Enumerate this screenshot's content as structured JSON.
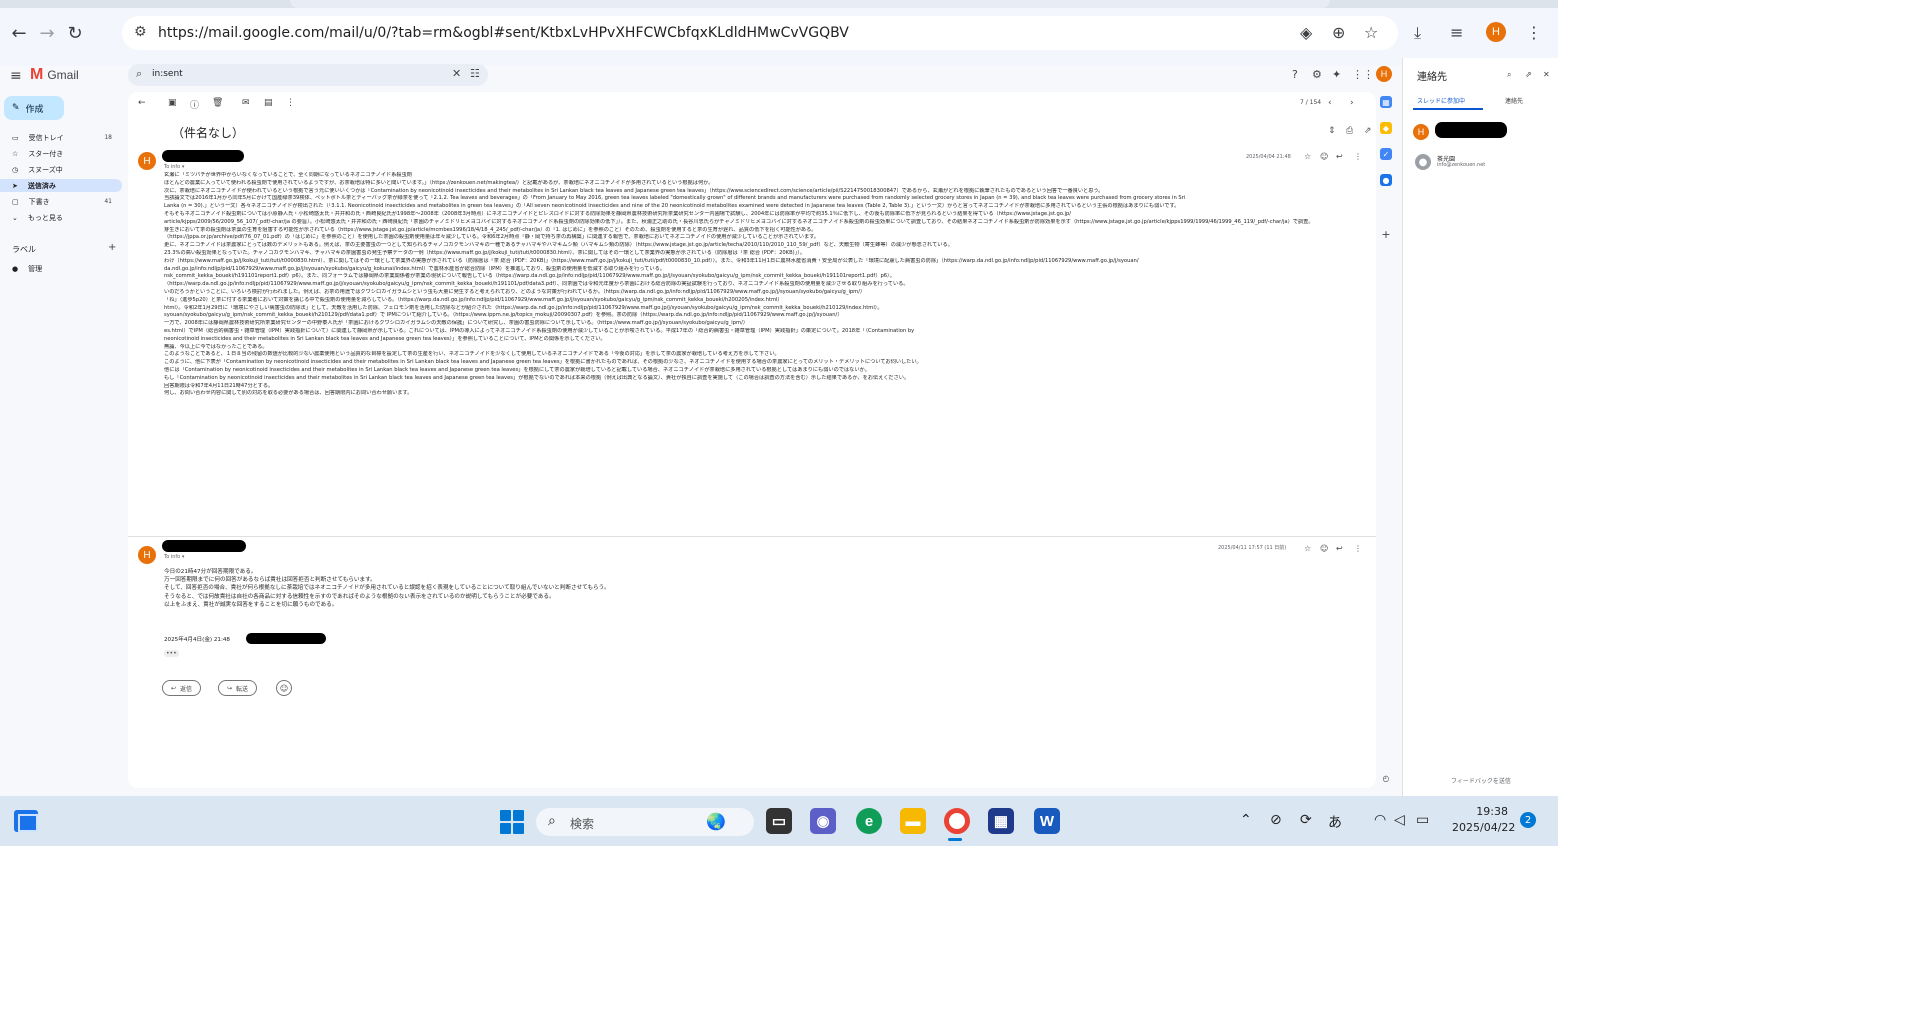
{
  "browser": {
    "url": "https://mail.google.com/mail/u/0/?tab=rm&ogbl#sent/KtbxLvHPvXHFCWCbfqxKLdldHMwCvVGQBV",
    "profile_initial": "H"
  },
  "gmail": {
    "brand": "Gmail",
    "search_value": "in:sent",
    "compose_label": "作成",
    "nav": [
      {
        "label": "受信トレイ",
        "count": "18"
      },
      {
        "label": "スター付き",
        "count": ""
      },
      {
        "label": "スヌーズ中",
        "count": ""
      },
      {
        "label": "送信済み",
        "count": ""
      },
      {
        "label": "下書き",
        "count": "41"
      },
      {
        "label": "もっと見る",
        "count": ""
      }
    ],
    "labels_heading": "ラベル",
    "labels": [
      {
        "label": "管理"
      }
    ],
    "profile_initial": "H"
  },
  "thread": {
    "pager": "7 / 154",
    "subject": "（件名なし）",
    "messages": [
      {
        "avatar": "H",
        "to": "To info ▾",
        "date": "2025/04/04 21:48",
        "body": [
          "玄瀬に「ミツバチが世界中からいなくなっていることで、全く同期になっているネオニコチノイド系殺虫剤",
          "ほとんどの農業に入っていて使われる殺虫剤で使用されているようですが、お茶栽培は特に多いと聞いています。」（https://zenkouen.net/makingtea/）と記載があるが、茶栽培にネオニコチノイドが多用されているという根拠は何か。",
          "次に、茶栽培にネオニコチノイドが使われているという根拠で言う元に使いいくつかは「Contamination by neonicotinoid insecticides and their metabolites in Sri Lankan black tea leaves and Japanese green tea leaves」（https://www.sciencedirect.com/science/article/pii/S2214750018300847）であるから、玄瀬がどれを根拠に執筆されたものであるという回答で一番良いと思う。",
          "当該論文では2016年1月から同年5月にかけて国産緑茶39検体、ペットボトル茶とティーバッグ茶が緑茶を使って「2.1.2. Tea leaves and beverages」の「From January to May 2016, green tea leaves labeled \"domestically grown\" of different brands and manufacturers were purchased from randomly selected grocery stores in Japan (n = 39), and black tea leaves were purchased from grocery stores in Sri",
          "Lanka (n = 30).」という一文）各々ネオニコチノイドが検出された（「3.1.1. Neonicotinoid insecticides and metabolites in green tea leaves」の「All seven neonicotinoid insecticides and nine of the 20 neonicotinoid metabolites examined were detected in Japanese tea leaves (Table 2, Table 3).」という一文）からと言ってネオニコチノイドが茶栽培に多用されているという主張の根拠はあまりにも弱いです。",
          "そもそもネオニコチノイド殺虫剤については小原静人氏・小松崎悠太氏・井井和の氏・西崎良紀氏が1998年〜2008年（2008年3月時点）にネオニコチノイドとピレスロイドに対する防除効果を静岡県農林技術研究所茶業研究センター内圃場で試験し、2004年には防除率が平均で約35.1％に低下し、その後も防除率に低下が見られるという結果を得ている（https://www.jstage.jst.go.jp/",
          "article/kjpps/2009/56/2009_56_107/_pdf/-char/ja の要旨）。小松崎悠太氏・井井和の氏・西崎良紀氏「茶園のチャノミドリヒメヨコバイに対するネオニコチノイド系殺虫剤の防除効果の低下」）。また、秋浦正之助の氏・長谷川忠氏らがチャノミドリヒメヨコバイに対するネオニコチノイド系殺虫剤の殺虫効果について調査しており、その結果ネオニコチノイド系殺虫剤が防除効果を示す（https://www.jstage.jst.go.jp/article/kjpps1999/1999/46/1999_46_119/_pdf/-char/ja）で調査。",
          "芽生きにおいて茶の殺虫剤は茶葉の生育を阻害する可能性が示されている（https://www.jstage.jst.go.jp/article/mcmbes1996/18/4/18_4_245/_pdf/-char/ja）の「1. はじめに」を参照のこと）そのため、殺虫剤を使用すると茶の生育が遅れ、品質の低下を招く可能性がある。",
          "（https://jppa.or.jp/archive/pdf/76_07_01.pdf）の「はじめに」を参照のこと）を使用した茶園の殺虫剤使用量は年々減少している。令和6年2月時点「静・岡で持ち茶の再構築」に関連する報告で、茶栽培においてネオニコチノイドの使用が減少していることが示されています。",
          "更に、ネオニコチノイドは茶農家にとっては数のデメリットもある。例えば、茶の主要害虫の一つとして知られるチャノコカクモンハマキの一種であるチャハマキやハマキムシ類（ハマキムシ類の防除）（https://www.jstage.jst.go.jp/article/techa/2010/110/2010_110_59/_pdf）など、天敵生物（寄生蜂等）の減少が懸念されている。",
          "23.3%の高い殺虫効果となっていた。チャノコカクモンハマキ、チャハマキの茶園害虫の発生予察データの一例（https://www.maff.go.jp/j/kokuji_tuti/tuti/t0000830.html）、茶に関してはその一環として茶業界の実態が示されている（防除暦は「茶 総合 (PDF：20KB)」）。",
          "わけ（https://www.maff.go.jp/j/kokuji_tuti/tuti/t0000830.html）、茶に関してはその一環として茶業界の実態が示されている（防除暦は「茶 総合 (PDF：20KB)」（https://www.maff.go.jp/j/kokuji_tuti/tuti/pdf/t0000830_10.pdf））。また、令和3年11月1日に農林水産省消費・安全局が公表した「環境に配慮した病害虫の防除」（https://warp.da.ndl.go.jp/info:ndljp/pid/11067929/www.maff.go.jp/j/syouan/",
          "da.ndl.go.jp/info:ndljp/pid/11067929/www.maff.go.jp/j/syouan/syokubo/gaicyu/g_kokunai/index.html）で農林水産省が総合防除（IPM）を推進しており、殺虫剤の使用量を低減する取り組みを行っている。",
          "nsk_commit_kekka_boueki/h191101report1.pdf）p6）。また、同フォーラムでは静岡県の茶業関係者が茶業の現状について報告している（https://warp.da.ndl.go.jp/info:ndljp/pid/11067929/www.maff.go.jp/j/syouan/syokubo/gaicyu/g_ipm/nsk_commit_kekka_boueki/h191101report1.pdf）p6）。",
          "（https://warp.da.ndl.go.jp/info:ndljp/pid/11067929/www.maff.go.jp/j/syouan/syokubo/gaicyu/g_ipm/nsk_commit_kekka_boueki/h191101/pdf/data3.pdf）、同茶園では令和元年度から茶園における総合防除の実証試験を行っており、ネオニコチノイド系殺虫剤の使用量を減少させる取り組みを行っている。",
          "いのだろうかということに、いろいろ検討が行われました。例えば、お茶の用途ではクワシロカイガラムシという虫も大量に発生すると考えられており、どのような対策が行われているか。（https://warp.da.ndl.go.jp/info:ndljp/pid/11067929/www.maff.go.jp/j/syouan/syokubo/gaicyu/g_ipm/）",
          "「ね」（進歩5p20）と茶に付する茶業者において対策を講じる中で殺虫剤の使用量を減らしている。（https://warp.da.ndl.go.jp/info:ndljp/pid/11067929/www.maff.go.jp/j/syouan/syokubo/gaicyu/g_ipm/nsk_commit_kekka_boueki/h200205/index.html）",
          "html）。令和2年1月29日に「環境にやさしい病害虫の防除法」として、天敵を活用した防除、フェロモン剤を活用した防除などが紹介された（https://warp.da.ndl.go.jp/info:ndljp/pid/11067929/www.maff.go.jp/j/syouan/syokubo/gaicyu/g_ipm/nsk_commit_kekka_boueki/h210129/index.html）。",
          "syouan/syokubo/gaicyu/g_ipm/nsk_commit_kekka_boueki/h210129/pdf/data1.pdf）で IPMについて紹介している。（https://www.ippm.ne.jp/topics_mokuji/20090307.pdf）を参照。茶の防除（https://warp.da.ndl.go.jp/info:ndljp/pid/11067929/www.maff.go.jp/j/syouan/）",
          "一方で、2008年には静岡県農林技術研究所茶業研究センターの中野泰人氏が「茶園におけるクワシロカイガラムシの天敵の保護」について研究し、茶園の害虫防除について示している。（https://www.maff.go.jp/j/syouan/syokubo/gaicyu/g_ipm/）",
          "es.html）でIPM（総合的病害虫・雑草管理（IPM）実践指針について）に関連して静岡県が示している。これについては、IPMの導入によってネオニコチノイド系殺虫剤の使用が減少していることが示唆されている。平成17年の「総合的病害虫・雑草管理（IPM）実践指針」の策定について。2018年「（Contamination by",
          "neonicotinoid insecticides and their metabolites in Sri Lankan black tea leaves and Japanese green tea leaves）」を参照していることについて、IPMとの関係を示してください。",
          "無論、今以上に今ではなかったことである。",
          "このようなことであると、１日８当の残留の数値が比較的少ない農薬使用という品質的な目標を設定して茶の生産を行い、ネオニコチノイドを少なくして使用しているネオニコチノイドである「今後の対応」を示して茶の農家が栽培している考え方を示して下さい。",
          "このように、他に下表が「Contamination by neonicotinoid insecticides and their metabolites in Sri Lankan black tea leaves and Japanese green tea leaves」を根拠に書かれたものであれば、その根拠の少なさ、ネオニコチノイドを使用する場合の茶農家にとってのメリット・デメリットについてお伺いしたい。",
          "他には「Contamination by neonicotinoid insecticides and their metabolites in Sri Lankan black tea leaves and Japanese green tea leaves」を根拠にして茶の農家が栽培していると記載している場合、ネオニコチノイドが茶栽培に多用されている根拠としてはあまりにも弱いのではないか。",
          "もし「Contamination by neonicotinoid insecticides and their metabolites in Sri Lankan black tea leaves and Japanese green tea leaves」が根拠でないのであれば本来の根拠（例えば出典となる論文）、貴社が独自に調査を実施して（この場合は調査の方法を含む）示した結果であるか、をお伝えください。",
          "回答期限は令和7年4月11日21時47分とする。",
          "何し、お問い合わせ内容に関して別の対応を取る必要がある場合は、回答期限内にお問い合わせ願います。"
        ]
      },
      {
        "avatar": "H",
        "to": "To info ▾",
        "date": "2025/04/11 17:57 (11 日前)",
        "body": [
          "今日の21時47分が回答期限である。",
          "万一回答期限までに何の回答があるならば貴社は回答拒否と判断させてもらいます。",
          "そして、回答拒否の場合、貴社が何ら根拠なしに茶栽培ではネオニコチノイドが多用されていると誤認を招く表現をしていることについて取り組んでいないと判断させてもらう。",
          "そうなると、では何故貴社は自社の各商品に対する信頼性を示すのであればそのような根拠のない表示をされているのか説明してもらうことが必要である。",
          "以上をふまえ、貴社が誠実な回答をすることを切に願うものである。"
        ],
        "signature": "2025年4月4日(金) 21:48"
      }
    ],
    "reply_label": "返信",
    "forward_label": "転送"
  },
  "side_panel": {
    "title": "連絡先",
    "tabs": [
      "スレッドに参加中",
      "連絡先"
    ],
    "contact": {
      "name": "茶光園",
      "email": "info@zenkouen.net"
    },
    "feedback": "フィードバックを送信"
  },
  "taskbar": {
    "search_placeholder": "検索",
    "clock_time": "19:38",
    "clock_date": "2025/04/22",
    "notification_count": "2",
    "ime": "あ"
  },
  "colors": {
    "accent_blue": "#0b57d0",
    "avatar_orange": "#e8710a",
    "compose_bg": "#c2e7ff"
  }
}
